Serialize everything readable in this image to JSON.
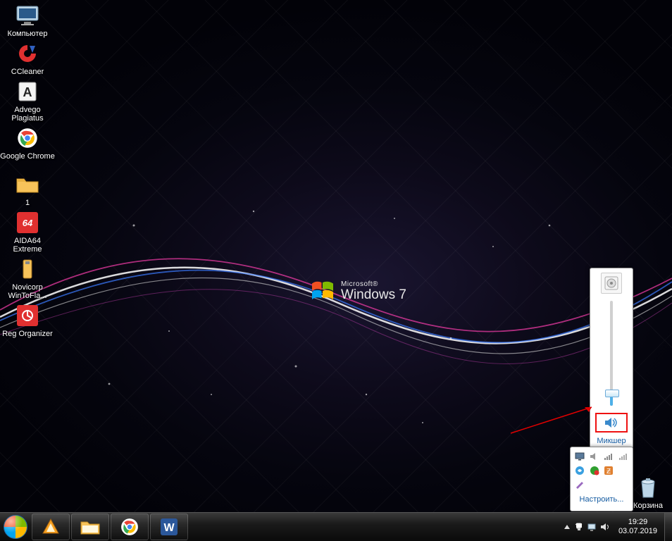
{
  "wallpaper": {
    "brand_small": "Microsoft®",
    "brand_large": "Windows 7"
  },
  "desktop_icons": [
    {
      "id": "computer",
      "label": "Компьютер",
      "color": "#cfe3f0"
    },
    {
      "id": "ccleaner",
      "label": "CCleaner",
      "color": "#e03030"
    },
    {
      "id": "advego",
      "label": "Advego Plagiatus",
      "color": "#f0f0f0"
    },
    {
      "id": "chrome",
      "label": "Google Chrome",
      "color": "#ffffff"
    },
    {
      "id": "folder1",
      "label": "1",
      "color": "#f7c35a"
    },
    {
      "id": "aida64",
      "label": "AIDA64 Extreme",
      "color": "#e03030"
    },
    {
      "id": "novicorp",
      "label": "Novicorp WinToFla...",
      "color": "#f7c35a"
    },
    {
      "id": "regorg",
      "label": "Reg Organizer",
      "color": "#e03030"
    }
  ],
  "recycle": {
    "label": "Корзина"
  },
  "volume_flyout": {
    "mixer_label": "Микшер",
    "level_percent": 10
  },
  "tray_overflow": {
    "configure_label": "Настроить..."
  },
  "taskbar_apps": [
    "aimp",
    "explorer",
    "chrome",
    "word"
  ],
  "tray_icons": [
    "overflow",
    "flag",
    "network",
    "volume",
    "lang"
  ],
  "clock": {
    "time": "19:29",
    "date": "03.07.2019"
  }
}
